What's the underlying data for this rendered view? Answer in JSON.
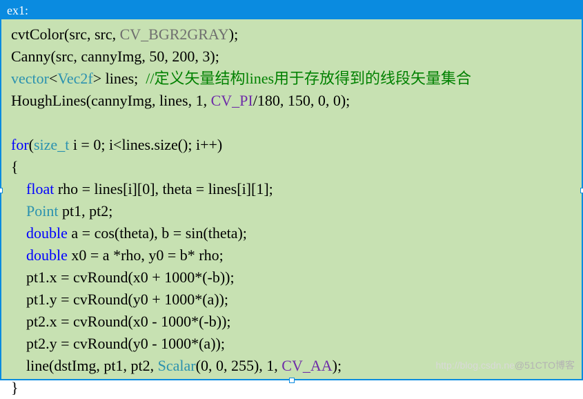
{
  "title": "ex1:",
  "code": {
    "l1_a": "cvtColor(src, src, ",
    "l1_b": "CV_BGR2GRAY",
    "l1_c": ");",
    "l2": "Canny(src, cannyImg, 50, 200, 3);",
    "l3_a": "vector",
    "l3_b": "<",
    "l3_c": "Vec2f",
    "l3_d": "> lines;  ",
    "l3_e": "//定义矢量结构lines用于存放得到的线段矢量集合",
    "l4_a": "HoughLines(cannyImg, lines, 1, ",
    "l4_b": "CV_PI",
    "l4_c": "/180, 150, 0, 0);",
    "l5": "",
    "l6_a": "for",
    "l6_b": "(",
    "l6_c": "size_t",
    "l6_d": " i = 0; i<lines.size(); i++)",
    "l7": "{",
    "l8_a": "    ",
    "l8_b": "float",
    "l8_c": " rho = lines[i][0], theta = lines[i][1];",
    "l9_a": "    ",
    "l9_b": "Point",
    "l9_c": " pt1, pt2;",
    "l10_a": "    ",
    "l10_b": "double",
    "l10_c": " a = cos(theta), b = sin(theta);",
    "l11_a": "    ",
    "l11_b": "double",
    "l11_c": " x0 = a *rho, y0 = b* rho;",
    "l12": "    pt1.x = cvRound(x0 + 1000*(-b));",
    "l13": "    pt1.y = cvRound(y0 + 1000*(a));",
    "l14": "    pt2.x = cvRound(x0 - 1000*(-b));",
    "l15": "    pt2.y = cvRound(y0 - 1000*(a));",
    "l16_a": "    line(dstImg, pt1, pt2, ",
    "l16_b": "Scalar",
    "l16_c": "(0, 0, 255), 1, ",
    "l16_d": "CV_AA",
    "l16_e": ");",
    "l17": "}"
  },
  "watermark_faint": "http://blog.csdn.ne",
  "watermark": "@51CTO博客"
}
